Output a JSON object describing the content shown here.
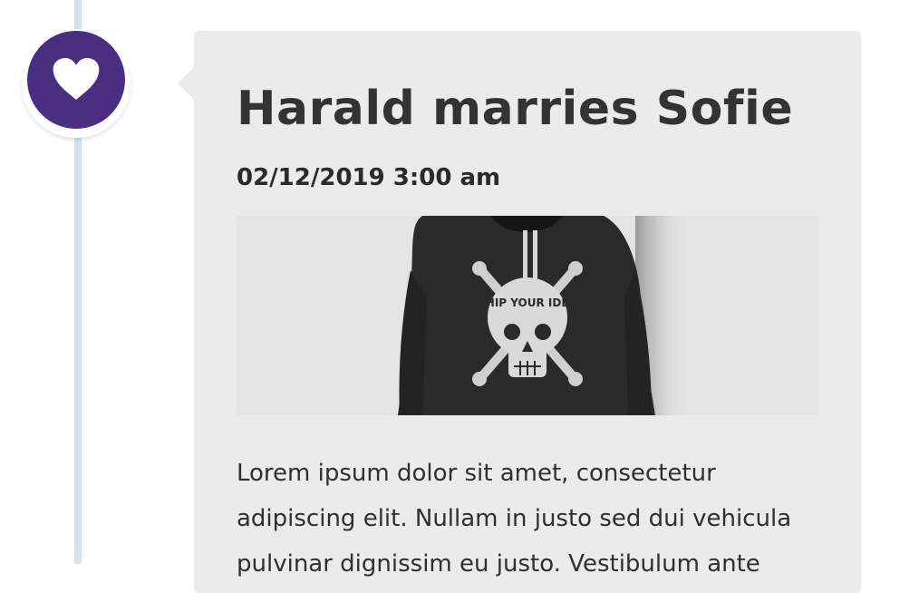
{
  "timeline": {
    "marker_icon": "heart-icon",
    "marker_color": "#4a2f80",
    "line_color": "#d3e3f0"
  },
  "entry": {
    "title": "Harald marries Sofie",
    "date": "02/12/2019 3:00 am",
    "image_subject": "black-hoodie-photo",
    "image_print_text": "SHIP YOUR IDEA",
    "body": "Lorem ipsum dolor sit amet, consectetur adipiscing elit. Nullam in justo sed dui vehicula pulvinar dignissim eu justo. Vestibulum ante"
  }
}
